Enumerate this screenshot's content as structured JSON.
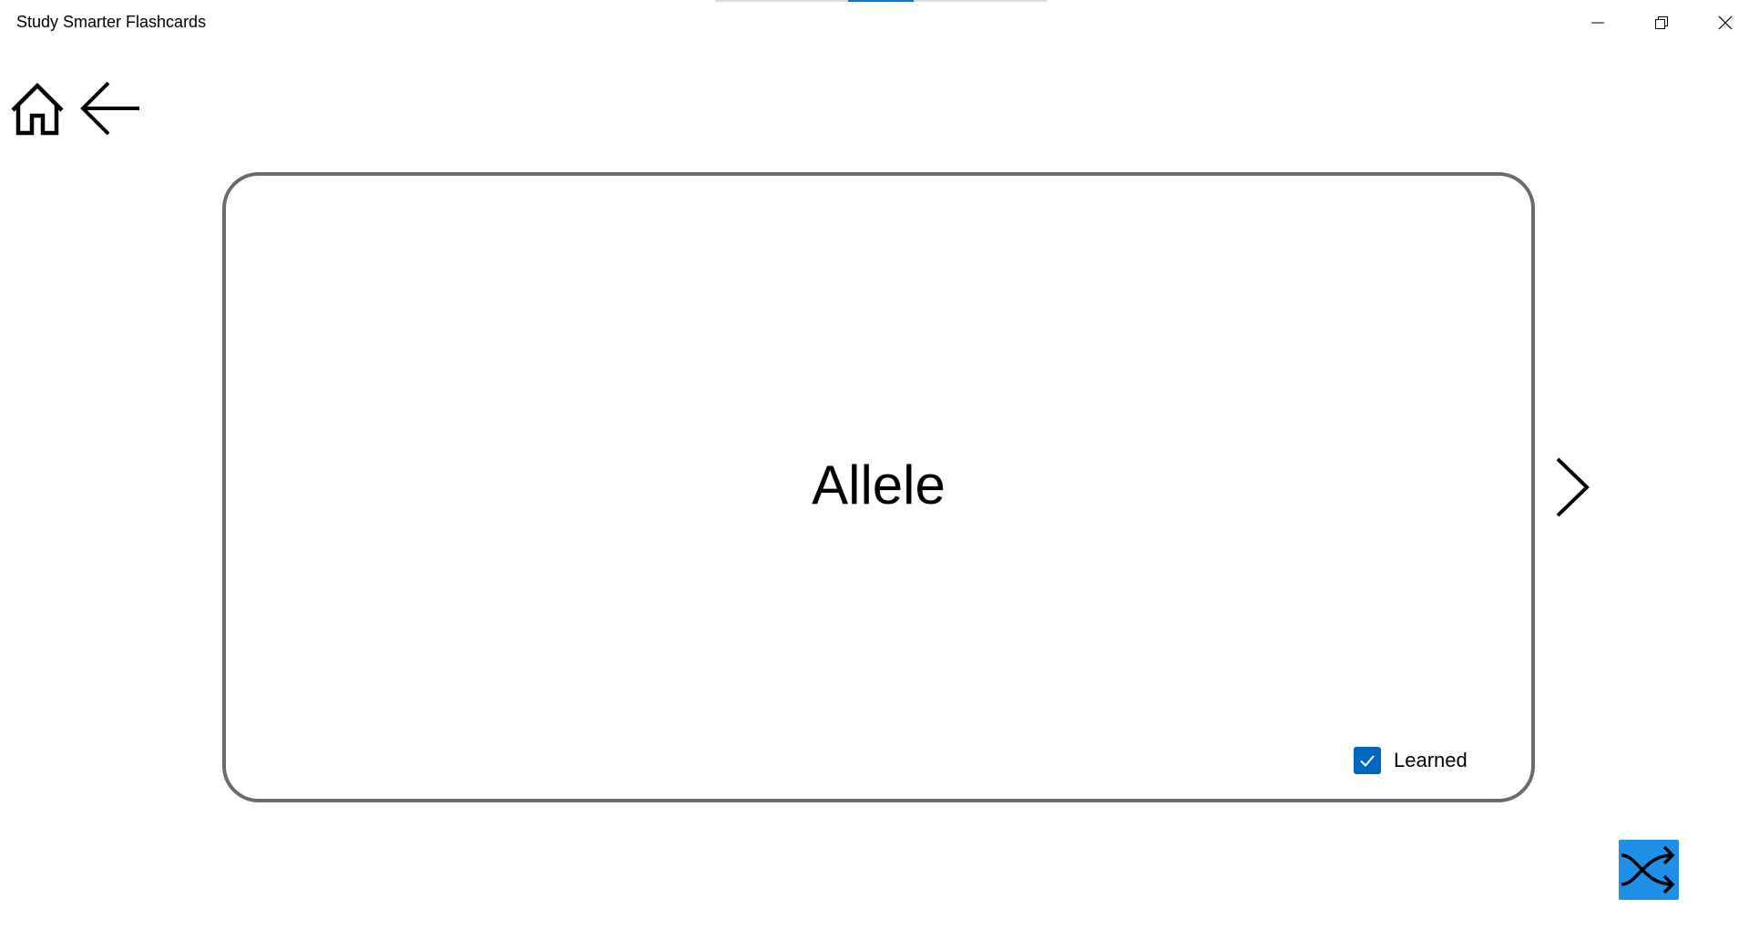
{
  "window": {
    "title": "Study Smarter Flashcards",
    "loading_progress": 0.4
  },
  "titlebar_buttons": {
    "minimize_icon": "minimize-icon",
    "restore_icon": "restore-icon",
    "close_icon": "close-icon"
  },
  "nav": {
    "home_icon": "home-icon",
    "back_icon": "arrow-left-icon"
  },
  "card": {
    "term": "Allele",
    "learned_label": "Learned",
    "learned_checked": true
  },
  "controls": {
    "next_icon": "chevron-right-icon",
    "shuffle_icon": "shuffle-icon"
  },
  "colors": {
    "accent": "#0067c0",
    "shuffle_bg": "#1e90e8",
    "card_border": "#6b6b6b",
    "loading_fill": "#0078d4"
  }
}
